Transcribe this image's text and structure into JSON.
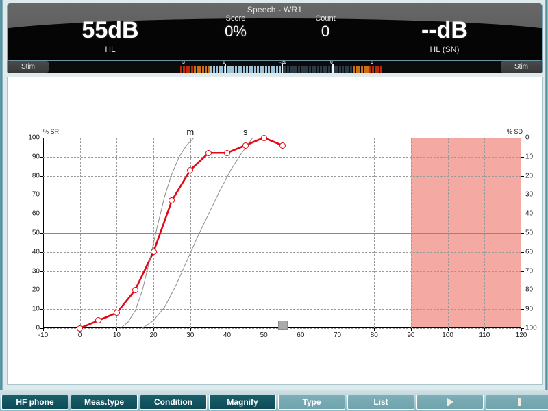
{
  "header": {
    "title": "Speech - WR1",
    "left": {
      "value": "55dB",
      "unit": "HL",
      "stim_label": "Stim"
    },
    "right": {
      "value": "--dB",
      "unit": "HL (SN)",
      "stim_label": "Stim"
    },
    "score": {
      "caption": "Score",
      "value": "0%"
    },
    "count": {
      "caption": "Count",
      "value": "0"
    },
    "vu_labels": [
      "3",
      "0",
      "-20",
      "0",
      "3"
    ]
  },
  "chart_data": {
    "type": "line",
    "title": "Speech - WR1",
    "xlabel": "",
    "ylabel": "% SR",
    "ylabel_right": "% SD",
    "xlim": [
      -10,
      120
    ],
    "ylim": [
      0,
      100
    ],
    "ylim_right": [
      0,
      100
    ],
    "grid": true,
    "legend_position": "inline-labels",
    "xticks": [
      -10,
      0,
      10,
      20,
      30,
      40,
      50,
      60,
      70,
      80,
      90,
      100,
      110,
      120
    ],
    "yticks": [
      0,
      10,
      20,
      30,
      40,
      50,
      60,
      70,
      80,
      90,
      100
    ],
    "yticks_right": [
      0,
      10,
      20,
      30,
      40,
      50,
      60,
      70,
      80,
      90,
      100
    ],
    "series": [
      {
        "name": "WR1",
        "color": "#e30613",
        "marker": "open-circle",
        "x": [
          0,
          5,
          10,
          15,
          20,
          25,
          30,
          35,
          40,
          45,
          50,
          55
        ],
        "values": [
          0,
          4,
          8,
          20,
          40,
          67,
          83,
          92,
          92,
          96,
          100,
          96
        ]
      },
      {
        "name": "m",
        "color": "#8c8c8c",
        "marker": "none",
        "x": [
          11,
          13,
          15,
          17,
          19,
          21,
          23,
          25,
          27,
          29,
          31
        ],
        "values": [
          0,
          3,
          9,
          20,
          36,
          53,
          69,
          81,
          90,
          96,
          100
        ]
      },
      {
        "name": "s",
        "color": "#8c8c8c",
        "marker": "none",
        "x": [
          17,
          20,
          23,
          26,
          29,
          32,
          35,
          38,
          41,
          44,
          47
        ],
        "values": [
          0,
          4,
          11,
          22,
          35,
          48,
          60,
          72,
          83,
          92,
          100
        ]
      }
    ],
    "curve_labels": [
      {
        "text": "m",
        "x": 30,
        "y": 100
      },
      {
        "text": "s",
        "x": 45,
        "y": 100
      }
    ],
    "shaded_region": {
      "x_from": 90,
      "x_to": 120,
      "color": "#f4aaa2"
    },
    "mid_line_y": 50,
    "cursor_marker": {
      "x": 55,
      "y": 0,
      "color": "#aaaaaa"
    }
  },
  "toolbar": {
    "buttons": [
      {
        "label": "HF phone",
        "style": "dark",
        "icon": ""
      },
      {
        "label": "Meas.type",
        "style": "dark",
        "icon": ""
      },
      {
        "label": "Condition",
        "style": "dark",
        "icon": ""
      },
      {
        "label": "Magnify",
        "style": "dark",
        "icon": ""
      },
      {
        "label": "Type",
        "style": "light",
        "icon": ""
      },
      {
        "label": "List",
        "style": "light",
        "icon": ""
      },
      {
        "label": "",
        "style": "light",
        "icon": "play-icon"
      },
      {
        "label": "",
        "style": "light",
        "icon": "pause-icon"
      }
    ]
  }
}
